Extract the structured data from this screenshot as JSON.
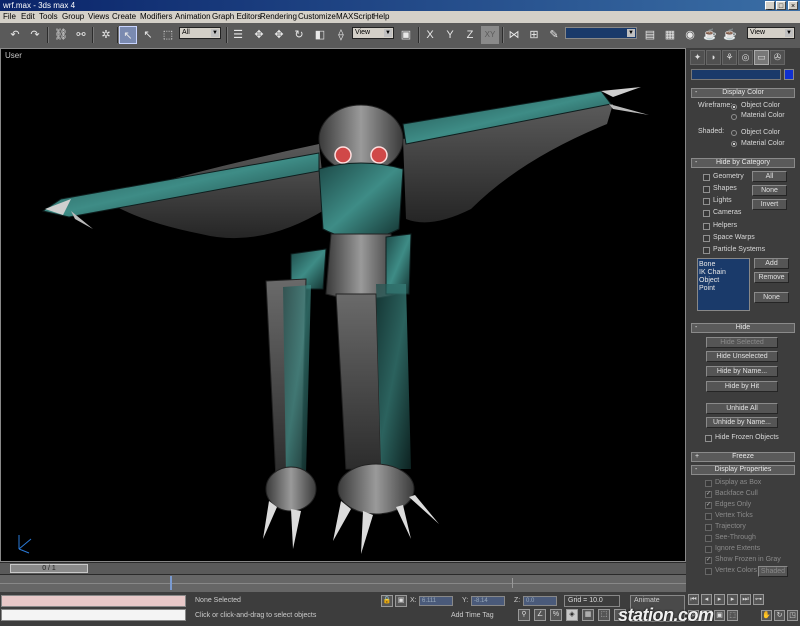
{
  "window": {
    "title": "wrf.max - 3ds max 4"
  },
  "menu": [
    "File",
    "Edit",
    "Tools",
    "Group",
    "Views",
    "Create",
    "Modifiers",
    "Animation",
    "Graph Editors",
    "Rendering",
    "Customize",
    "MAXScript",
    "Help"
  ],
  "toolbar": {
    "selection_filter": "All",
    "ref_coord": "View",
    "axis_x": "X",
    "axis_y": "Y",
    "axis_z": "Z",
    "axis_xy": "XY",
    "render_type": "View"
  },
  "viewport": {
    "label": "User"
  },
  "display_color": {
    "title": "Display Color",
    "wireframe_label": "Wireframe:",
    "shaded_label": "Shaded:",
    "object_color": "Object Color",
    "material_color": "Material Color",
    "wireframe_selected": "Object Color",
    "shaded_selected": "Material Color"
  },
  "hide_by_category": {
    "title": "Hide by Category",
    "categories": [
      "Geometry",
      "Shapes",
      "Lights",
      "Cameras",
      "Helpers",
      "Space Warps",
      "Particle Systems"
    ],
    "buttons": {
      "all": "All",
      "none": "None",
      "invert": "Invert"
    },
    "list_items": [
      "Bone",
      "IK Chain Object",
      "Point"
    ],
    "list_buttons": {
      "add": "Add",
      "remove": "Remove",
      "none": "None"
    }
  },
  "hide": {
    "title": "Hide",
    "buttons": [
      "Hide Selected",
      "Hide Unselected",
      "Hide by Name...",
      "Hide by Hit"
    ],
    "unhide_buttons": [
      "Unhide All",
      "Unhide by Name..."
    ],
    "hide_frozen": "Hide Frozen Objects"
  },
  "freeze": {
    "title": "Freeze",
    "sign": "+"
  },
  "display_properties": {
    "title": "Display Properties",
    "sign": "-",
    "items": [
      {
        "label": "Display as Box",
        "checked": false
      },
      {
        "label": "Backface Cull",
        "checked": true
      },
      {
        "label": "Edges Only",
        "checked": true
      },
      {
        "label": "Vertex Ticks",
        "checked": false
      },
      {
        "label": "Trajectory",
        "checked": false
      },
      {
        "label": "See-Through",
        "checked": false
      },
      {
        "label": "Ignore Extents",
        "checked": false
      },
      {
        "label": "Show Frozen in Gray",
        "checked": true
      },
      {
        "label": "Vertex Colors",
        "checked": false
      }
    ],
    "shaded_button": "Shaded"
  },
  "timeline": {
    "frame": "0 / 1"
  },
  "status": {
    "selection": "None Selected",
    "prompt": "Click or click-and-drag to select objects",
    "x_label": "X:",
    "y_label": "Y:",
    "z_label": "Z:",
    "x_value": "6.111",
    "y_value": "-8.14",
    "z_value": "0.0",
    "grid": "Grid = 10.0",
    "add_time_tag": "Add Time Tag",
    "animate": "Animate"
  },
  "watermark": "station.com",
  "colors": {
    "viewport_bg": "#000000",
    "ui_gray": "#3d3d3d",
    "list_blue": "#1a3a6a",
    "titlebar": "#0a246a"
  }
}
